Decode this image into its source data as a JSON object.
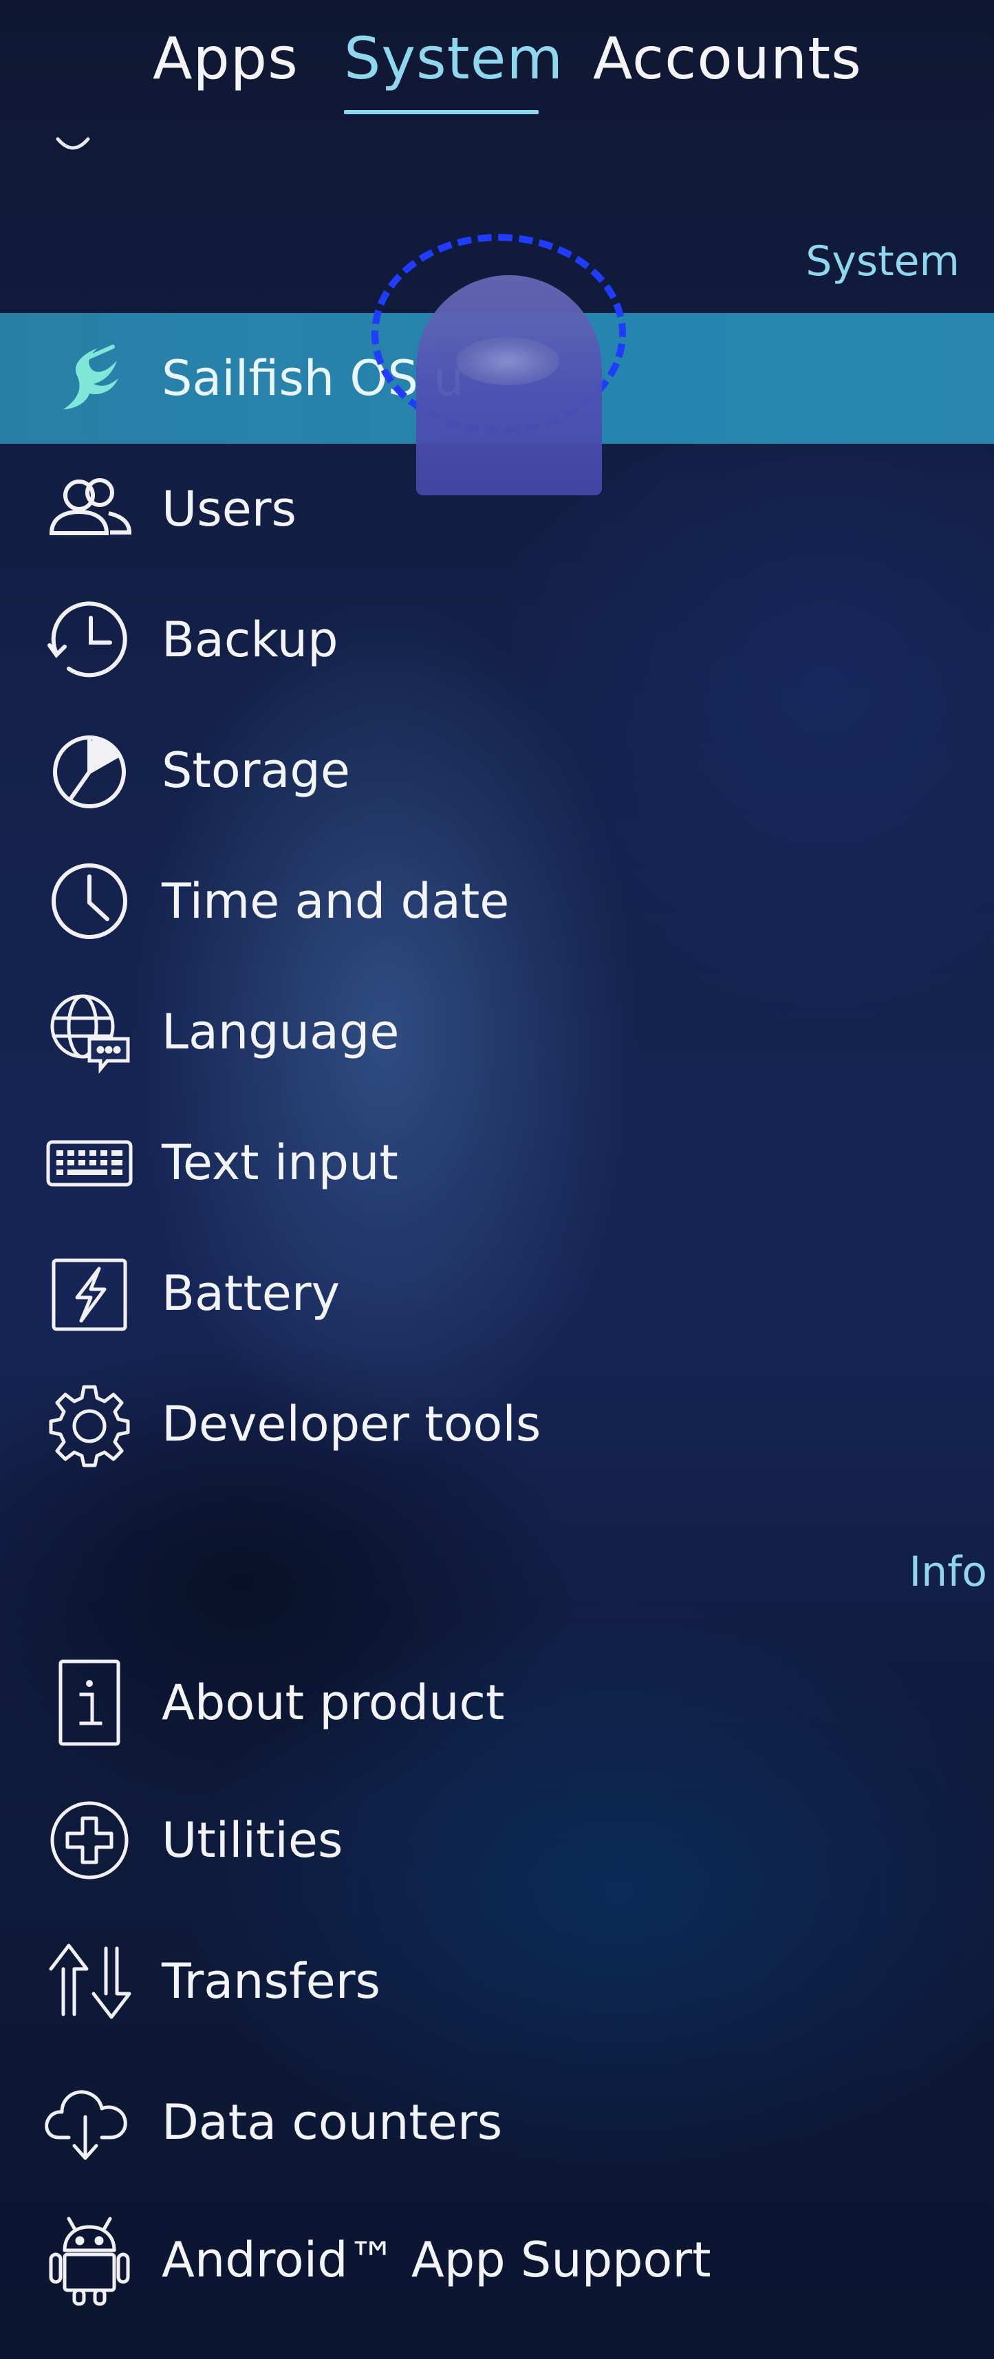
{
  "tabs": {
    "apps": "Apps",
    "system": "System",
    "accounts": "Accounts",
    "active": "System"
  },
  "sections": {
    "system_header": "System",
    "info_header": "Info"
  },
  "system_items": [
    {
      "label": "Sailfish OS u",
      "icon": "sailfish-icon",
      "highlighted": true
    },
    {
      "label": "Users",
      "icon": "users-icon"
    },
    {
      "label": "Backup",
      "icon": "backup-icon"
    },
    {
      "label": "Storage",
      "icon": "storage-icon"
    },
    {
      "label": "Time and date",
      "icon": "clock-icon"
    },
    {
      "label": "Language",
      "icon": "language-icon"
    },
    {
      "label": "Text input",
      "icon": "keyboard-icon"
    },
    {
      "label": "Battery",
      "icon": "battery-icon"
    },
    {
      "label": "Developer tools",
      "icon": "gear-icon"
    }
  ],
  "info_items": [
    {
      "label": "About product",
      "icon": "info-icon"
    },
    {
      "label": "Utilities",
      "icon": "utilities-icon"
    },
    {
      "label": "Transfers",
      "icon": "transfers-icon"
    },
    {
      "label": "Data counters",
      "icon": "cloud-download-icon"
    },
    {
      "label": "Android™ App Support",
      "icon": "android-icon"
    }
  ],
  "colors": {
    "accent": "#8fd7ee",
    "highlight": "#2a7fa6",
    "text": "#f3f4f8",
    "touch_ring": "#1f3cff"
  }
}
